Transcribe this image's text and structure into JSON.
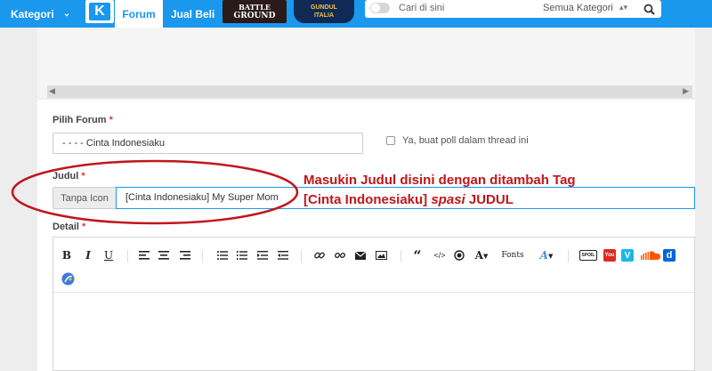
{
  "header": {
    "kategori_label": "Kategori",
    "logo_text": "K",
    "tab_forum": "Forum",
    "tab_jual_beli": "Jual Beli",
    "banner1_line1": "BATTLE",
    "banner1_line2": "GROUND",
    "banner2_line1": "GUNDUL",
    "banner2_line2": "ITALIA",
    "search_placeholder": "Cari di sini",
    "search_category": "Semua Kategori",
    "accent_color": "#1998ed"
  },
  "form": {
    "pilih_forum_label": "Pilih Forum",
    "required_mark": "*",
    "forum_value": "- - - - Cinta Indonesiaku",
    "poll_label": "Ya, buat poll dalam thread ini",
    "judul_label": "Judul",
    "tanpa_icon": "Tanpa Icon",
    "judul_value": "[Cinta Indonesiaku] My Super Mom",
    "detail_label": "Detail"
  },
  "annotation": {
    "line1": "Masukin Judul disini dengan ditambah Tag",
    "line2_prefix": "[Cinta Indonesiaku] ",
    "line2_italic": "spasi",
    "line2_suffix": " JUDUL",
    "color": "#c0161b"
  },
  "toolbar": {
    "bold": "B",
    "italic": "I",
    "underline": "U",
    "fonts": "Fonts",
    "size_a": "A",
    "text_color_a": "A",
    "code": "</>",
    "spoil": "SPOIL",
    "youtube": "You",
    "vimeo": "V",
    "dailymotion": "d"
  }
}
